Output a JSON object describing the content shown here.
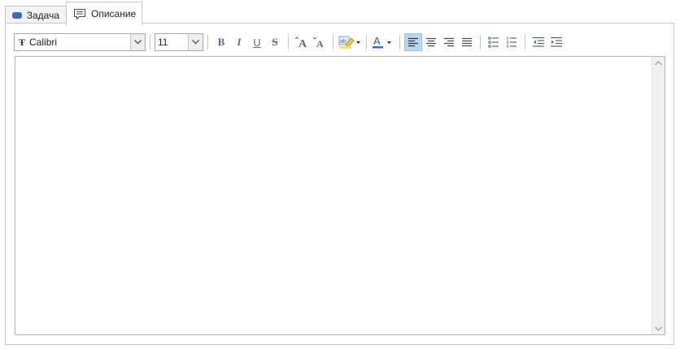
{
  "tabs": [
    {
      "label": "Задача",
      "icon": "task-icon"
    },
    {
      "label": "Описание",
      "icon": "comment-icon"
    }
  ],
  "toolbar": {
    "font_name": "Calibri",
    "font_size": "11",
    "active_alignment": "align-left",
    "accent_color": "#3a6fb8",
    "active_button_bg": "#b7d6f2"
  },
  "editor": {
    "content": ""
  }
}
